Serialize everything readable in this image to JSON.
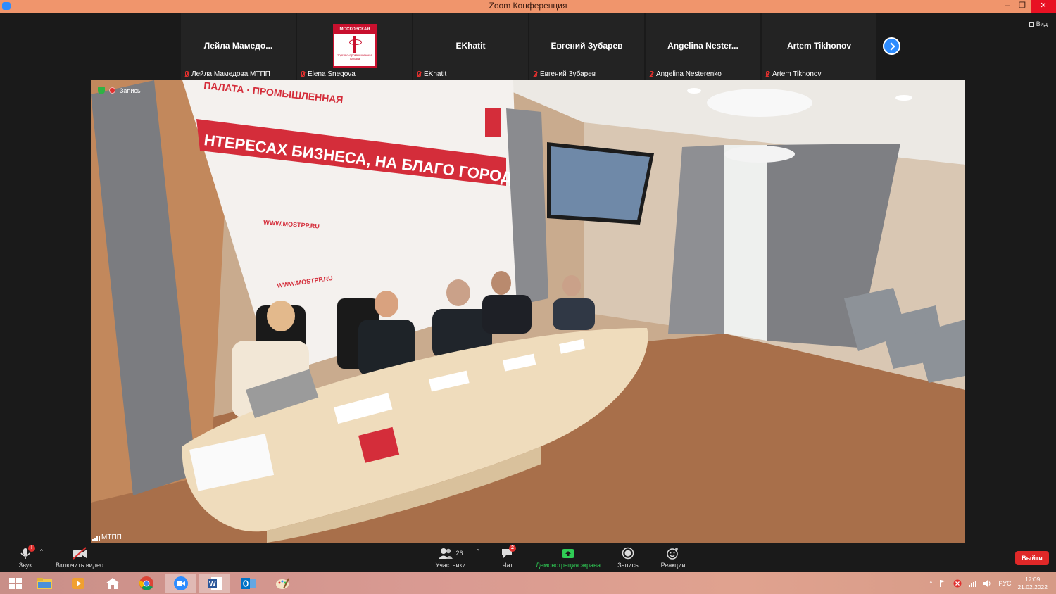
{
  "window": {
    "title": "Zoom Конференция",
    "minimize": "–",
    "restore": "❐",
    "close": "✕"
  },
  "view_button": "Вид",
  "participants_strip": [
    {
      "display": "Лейла  Мамедо...",
      "label": "Лейла Мамедова МТПП",
      "has_logo": false
    },
    {
      "display": "",
      "label": "Elena Snegova",
      "has_logo": true
    },
    {
      "display": "EKhatit",
      "label": "EKhatit",
      "has_logo": false
    },
    {
      "display": "Евгений Зубарев",
      "label": "Евгений Зубарев",
      "has_logo": false
    },
    {
      "display": "Angelina  Nester...",
      "label": "Angelina Nesterenko",
      "has_logo": false
    },
    {
      "display": "Artem Tikhonov",
      "label": "Artem Tikhonov",
      "has_logo": false
    }
  ],
  "logo": {
    "top": "МОСКОВСКАЯ",
    "bottom": "торгово-промышленная палата"
  },
  "main_video": {
    "recording_label": "Запись",
    "speaker": "МТПП",
    "backdrop_banner": "НТЕРЕСАХ БИЗНЕСА, НА БЛАГО ГОРОДА",
    "backdrop_top": "ПАЛАТА · ПРОМЫШЛЕННАЯ",
    "backdrop_url": "WWW.MOSTPP.RU"
  },
  "toolbar": {
    "audio": "Звук",
    "video": "Включить видео",
    "participants": "Участники",
    "participants_count": "26",
    "chat": "Чат",
    "chat_badge": "2",
    "share": "Демонстрация экрана",
    "record": "Запись",
    "reactions": "Реакции",
    "leave": "Выйти",
    "audio_badge": "!",
    "caret": "^"
  },
  "taskbar": {
    "language": "РУС",
    "time": "17:09",
    "date": "21.02.2022",
    "tray_caret": "^"
  },
  "colors": {
    "titlebar": "#f0956c",
    "accent_blue": "#2d8cff",
    "share_green": "#2fcc55",
    "leave_red": "#e02828",
    "brand_red": "#c8102e"
  }
}
